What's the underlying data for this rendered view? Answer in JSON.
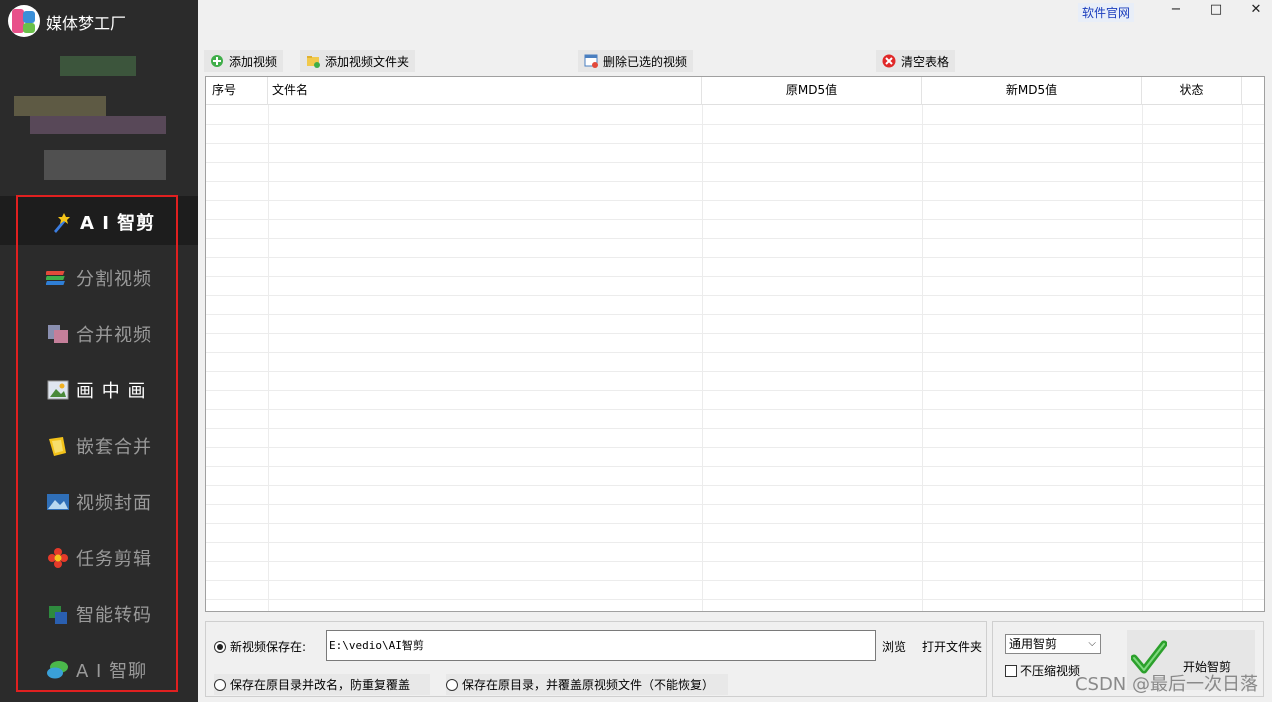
{
  "app": {
    "title": "媒体梦工厂"
  },
  "nav": {
    "items": [
      {
        "label": "A I 智剪",
        "icon": "ai-wand-icon"
      },
      {
        "label": "分割视频",
        "icon": "split-video-icon"
      },
      {
        "label": "合并视频",
        "icon": "merge-video-icon"
      },
      {
        "label": "画 中 画",
        "icon": "picture-in-picture-icon"
      },
      {
        "label": "嵌套合并",
        "icon": "nest-merge-icon"
      },
      {
        "label": "视频封面",
        "icon": "video-cover-icon"
      },
      {
        "label": "任务剪辑",
        "icon": "task-flower-icon"
      },
      {
        "label": "智能转码",
        "icon": "transcode-icon"
      },
      {
        "label": "A I 智聊",
        "icon": "chat-bubble-icon"
      }
    ]
  },
  "header": {
    "site_link": "软件官网",
    "minimize": "−",
    "maximize": "□",
    "close": "✕"
  },
  "toolbar": {
    "add_video": "添加视频",
    "add_folder": "添加视频文件夹",
    "delete_selected": "删除已选的视频",
    "clear_table": "清空表格"
  },
  "table": {
    "columns": [
      "序号",
      "文件名",
      "原MD5值",
      "新MD5值",
      "状态"
    ],
    "rows": []
  },
  "save": {
    "new_location_label": "新视频保存在:",
    "path": "E:\\vedio\\AI智剪",
    "browse": "浏览",
    "open_folder": "打开文件夹",
    "rename_in_place": "保存在原目录并改名，防重复覆盖",
    "overwrite_in_place": "保存在原目录，并覆盖原视频文件（不能恢复）"
  },
  "options": {
    "mode": "通用智剪",
    "no_compress": "不压缩视频",
    "start": "开始智剪"
  },
  "watermark": "CSDN @最后一次日落",
  "colors": {
    "sidebar_bg": "#2b2b2b",
    "highlight_frame": "#e02020",
    "link": "#1a3dbd"
  }
}
